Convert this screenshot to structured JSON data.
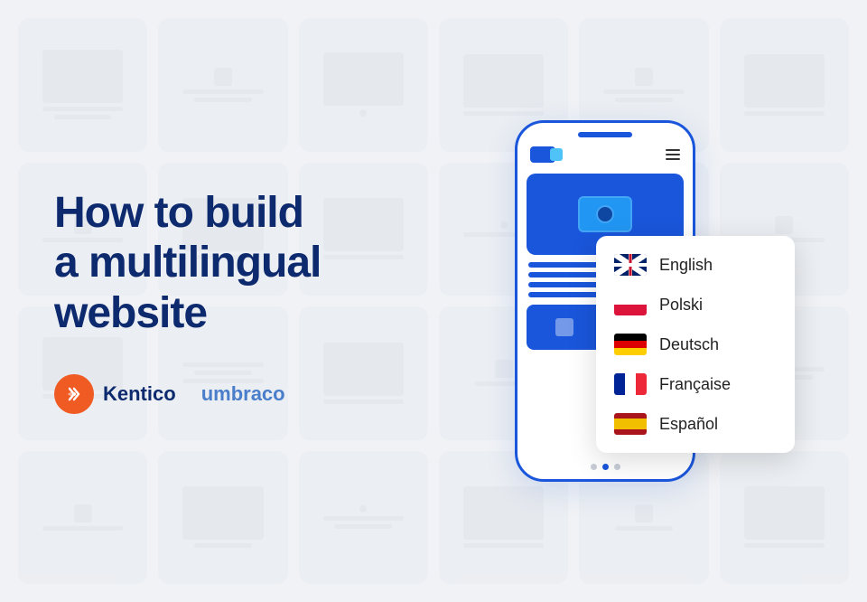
{
  "headline": {
    "line1": "How to build",
    "line2": "a multilingual",
    "line3": "website"
  },
  "logos": {
    "kentico_label": "Kentico",
    "umbraco_label": "umbraco"
  },
  "phone": {
    "dots": [
      {
        "active": false
      },
      {
        "active": true
      },
      {
        "active": false
      }
    ]
  },
  "languages": [
    {
      "name": "English",
      "flag_type": "uk"
    },
    {
      "name": "Polski",
      "flag_type": "pl"
    },
    {
      "name": "Deutsch",
      "flag_type": "de"
    },
    {
      "name": "Française",
      "flag_type": "fr"
    },
    {
      "name": "Español",
      "flag_type": "es"
    }
  ]
}
